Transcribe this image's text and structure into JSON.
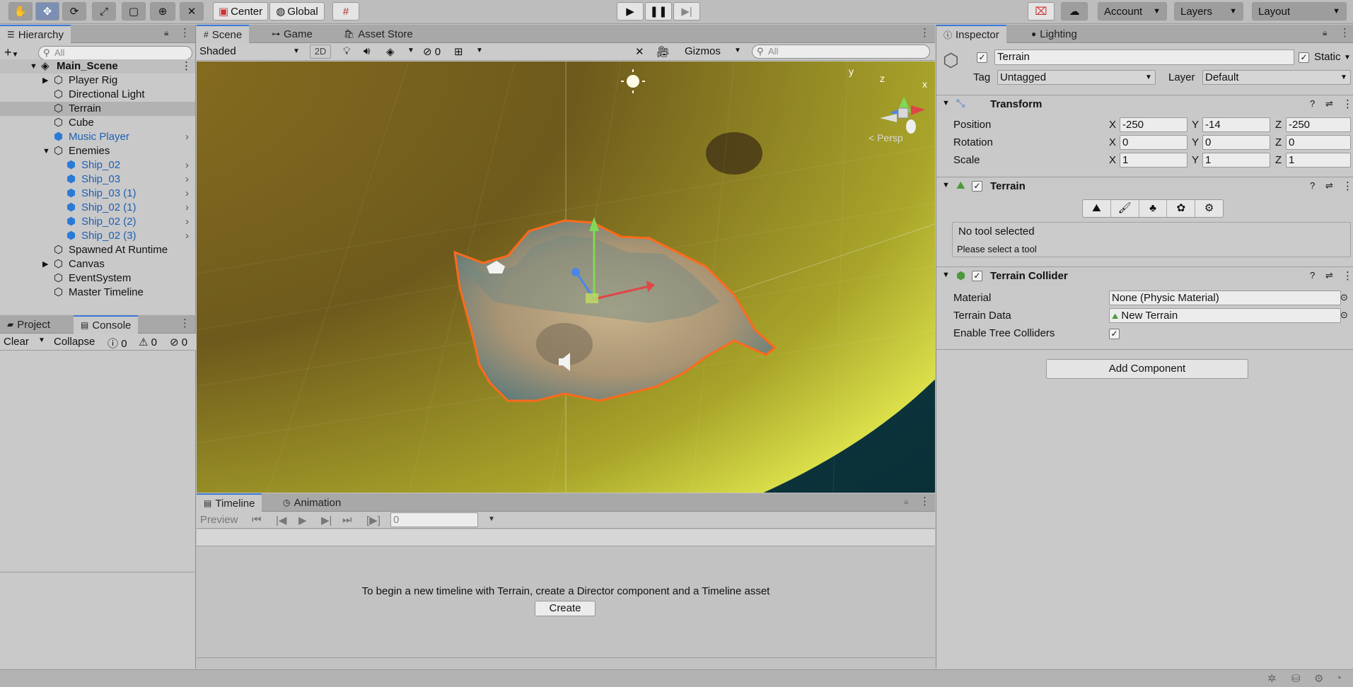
{
  "toolbar": {
    "pivot_label": "Center",
    "space_label": "Global",
    "account_label": "Account",
    "layers_label": "Layers",
    "layout_label": "Layout"
  },
  "hierarchy": {
    "tab_label": "Hierarchy",
    "search_placeholder": "All",
    "scene_name": "Main_Scene",
    "items": [
      {
        "label": "Player Rig"
      },
      {
        "label": "Directional Light"
      },
      {
        "label": "Terrain"
      },
      {
        "label": "Cube"
      },
      {
        "label": "Music Player"
      },
      {
        "label": "Enemies"
      },
      {
        "label": "Ship_02"
      },
      {
        "label": "Ship_03"
      },
      {
        "label": "Ship_03 (1)"
      },
      {
        "label": "Ship_02 (1)"
      },
      {
        "label": "Ship_02 (2)"
      },
      {
        "label": "Ship_02 (3)"
      },
      {
        "label": "Spawned At Runtime"
      },
      {
        "label": "Canvas"
      },
      {
        "label": "EventSystem"
      },
      {
        "label": "Master Timeline"
      }
    ]
  },
  "bottom_left": {
    "tabs": [
      "Project",
      "Console"
    ],
    "clear_label": "Clear",
    "collapse_label": "Collapse",
    "counts": [
      "0",
      "0",
      "0"
    ]
  },
  "scene": {
    "tabs": [
      "Scene",
      "Game",
      "Asset Store"
    ],
    "shading_mode": "Shaded",
    "mode_2d": "2D",
    "hidden_count": "0",
    "gizmos_label": "Gizmos",
    "search_placeholder": "All",
    "persp_label": "< Persp",
    "axis_y": "y",
    "axis_x": "x",
    "axis_z": "z"
  },
  "timeline": {
    "tabs": [
      "Timeline",
      "Animation"
    ],
    "preview_label": "Preview",
    "frame_value": "0",
    "message": "To begin a new timeline with Terrain, create a Director component and a Timeline asset",
    "create_label": "Create"
  },
  "inspector": {
    "tabs": [
      "Inspector",
      "Lighting"
    ],
    "object_name": "Terrain",
    "static_label": "Static",
    "tag_label": "Tag",
    "tag_value": "Untagged",
    "layer_label": "Layer",
    "layer_value": "Default",
    "transform": {
      "title": "Transform",
      "position_label": "Position",
      "rotation_label": "Rotation",
      "scale_label": "Scale",
      "axis_x": "X",
      "axis_y": "Y",
      "axis_z": "Z",
      "position": [
        "-250",
        "-14",
        "-250"
      ],
      "rotation": [
        "0",
        "0",
        "0"
      ],
      "scale": [
        "1",
        "1",
        "1"
      ]
    },
    "terrain": {
      "title": "Terrain",
      "no_tool": "No tool selected",
      "select_hint": "Please select a tool"
    },
    "terrain_collider": {
      "title": "Terrain Collider",
      "material_label": "Material",
      "material_value": "None (Physic Material)",
      "terrain_data_label": "Terrain Data",
      "terrain_data_value": "New Terrain",
      "enable_tree_label": "Enable Tree Colliders"
    },
    "add_component_label": "Add Component"
  },
  "colors": {
    "accent": "#3a79d8",
    "selection_outline": "#ff6a1a",
    "blue_text": "#1f5fb4"
  }
}
